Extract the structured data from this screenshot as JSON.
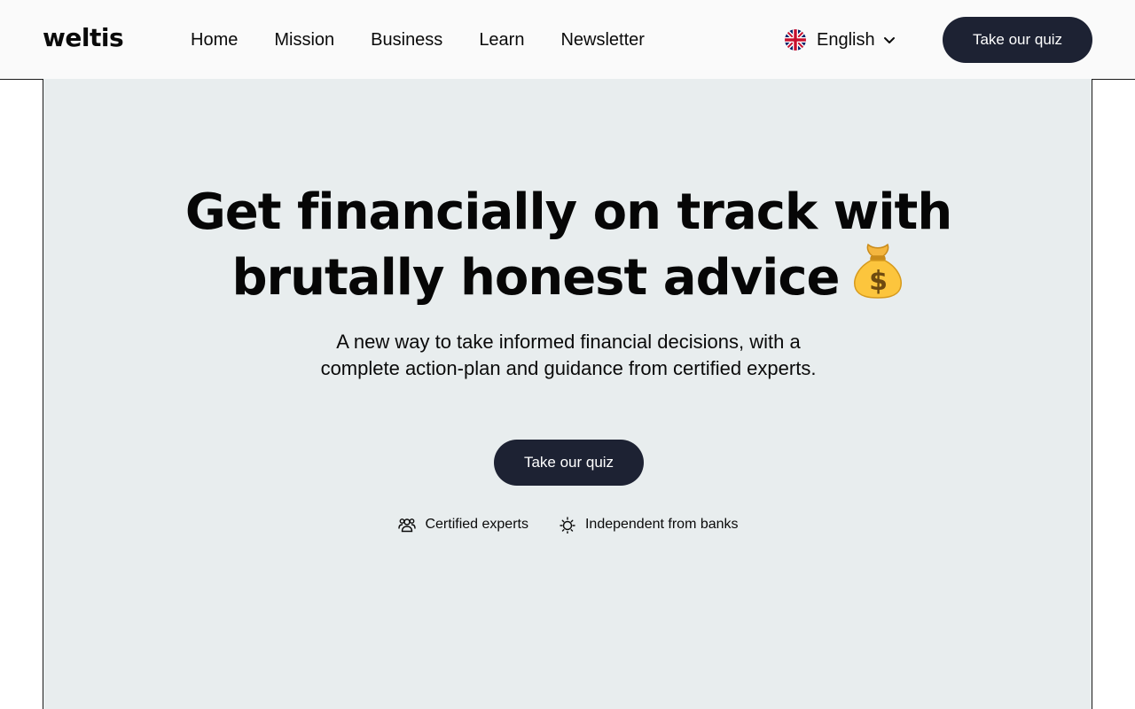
{
  "header": {
    "logo": "weltis",
    "nav": [
      "Home",
      "Mission",
      "Business",
      "Learn",
      "Newsletter"
    ],
    "language": {
      "label": "English",
      "flag": "uk-flag-icon"
    },
    "cta_label": "Take our quiz"
  },
  "hero": {
    "headline_lines": [
      "Get financially on track with",
      "brutally honest advice"
    ],
    "headline_emoji": "money-bag-icon",
    "subtitle_lines": [
      "A new way to take informed financial decisions, with a",
      "complete action-plan and guidance from certified experts."
    ],
    "cta_label": "Take our quiz",
    "features": [
      {
        "icon": "people-icon",
        "label": "Certified experts"
      },
      {
        "icon": "sun-icon",
        "label": "Independent from banks"
      }
    ]
  },
  "colors": {
    "header_bg": "#fafafa",
    "hero_bg": "#e8edee",
    "button_bg": "#1d2233",
    "button_text": "#ffffff",
    "text": "#0a0a0a"
  }
}
